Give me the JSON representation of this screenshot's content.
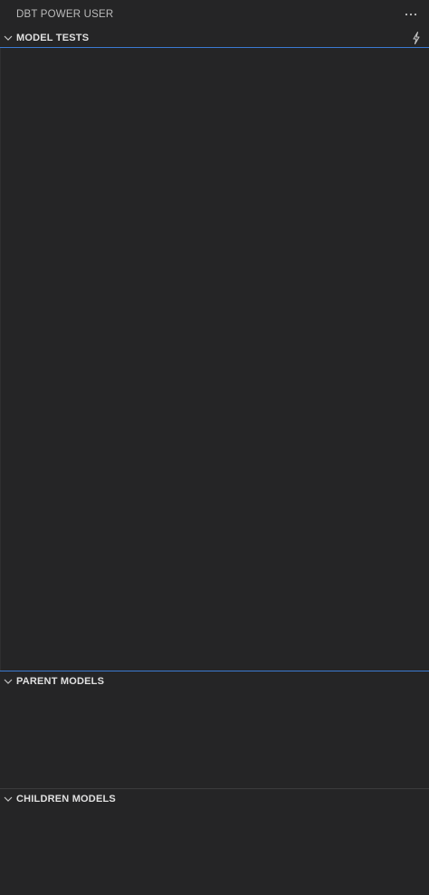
{
  "view": {
    "title": "DBT POWER USER",
    "more_icon": "ellipsis-icon"
  },
  "panes": {
    "model_tests": {
      "label": "MODEL TESTS",
      "chevron_icon": "chevron-down-icon",
      "action_icon": "lightning-bolt-icon"
    },
    "parent_models": {
      "label": "PARENT MODELS",
      "chevron_icon": "chevron-down-icon"
    },
    "children_models": {
      "label": "CHILDREN MODELS",
      "chevron_icon": "chevron-down-icon"
    }
  },
  "colors": {
    "background": "#252526",
    "focus_border": "#3b7ad1",
    "separator": "#3c3c3c"
  }
}
